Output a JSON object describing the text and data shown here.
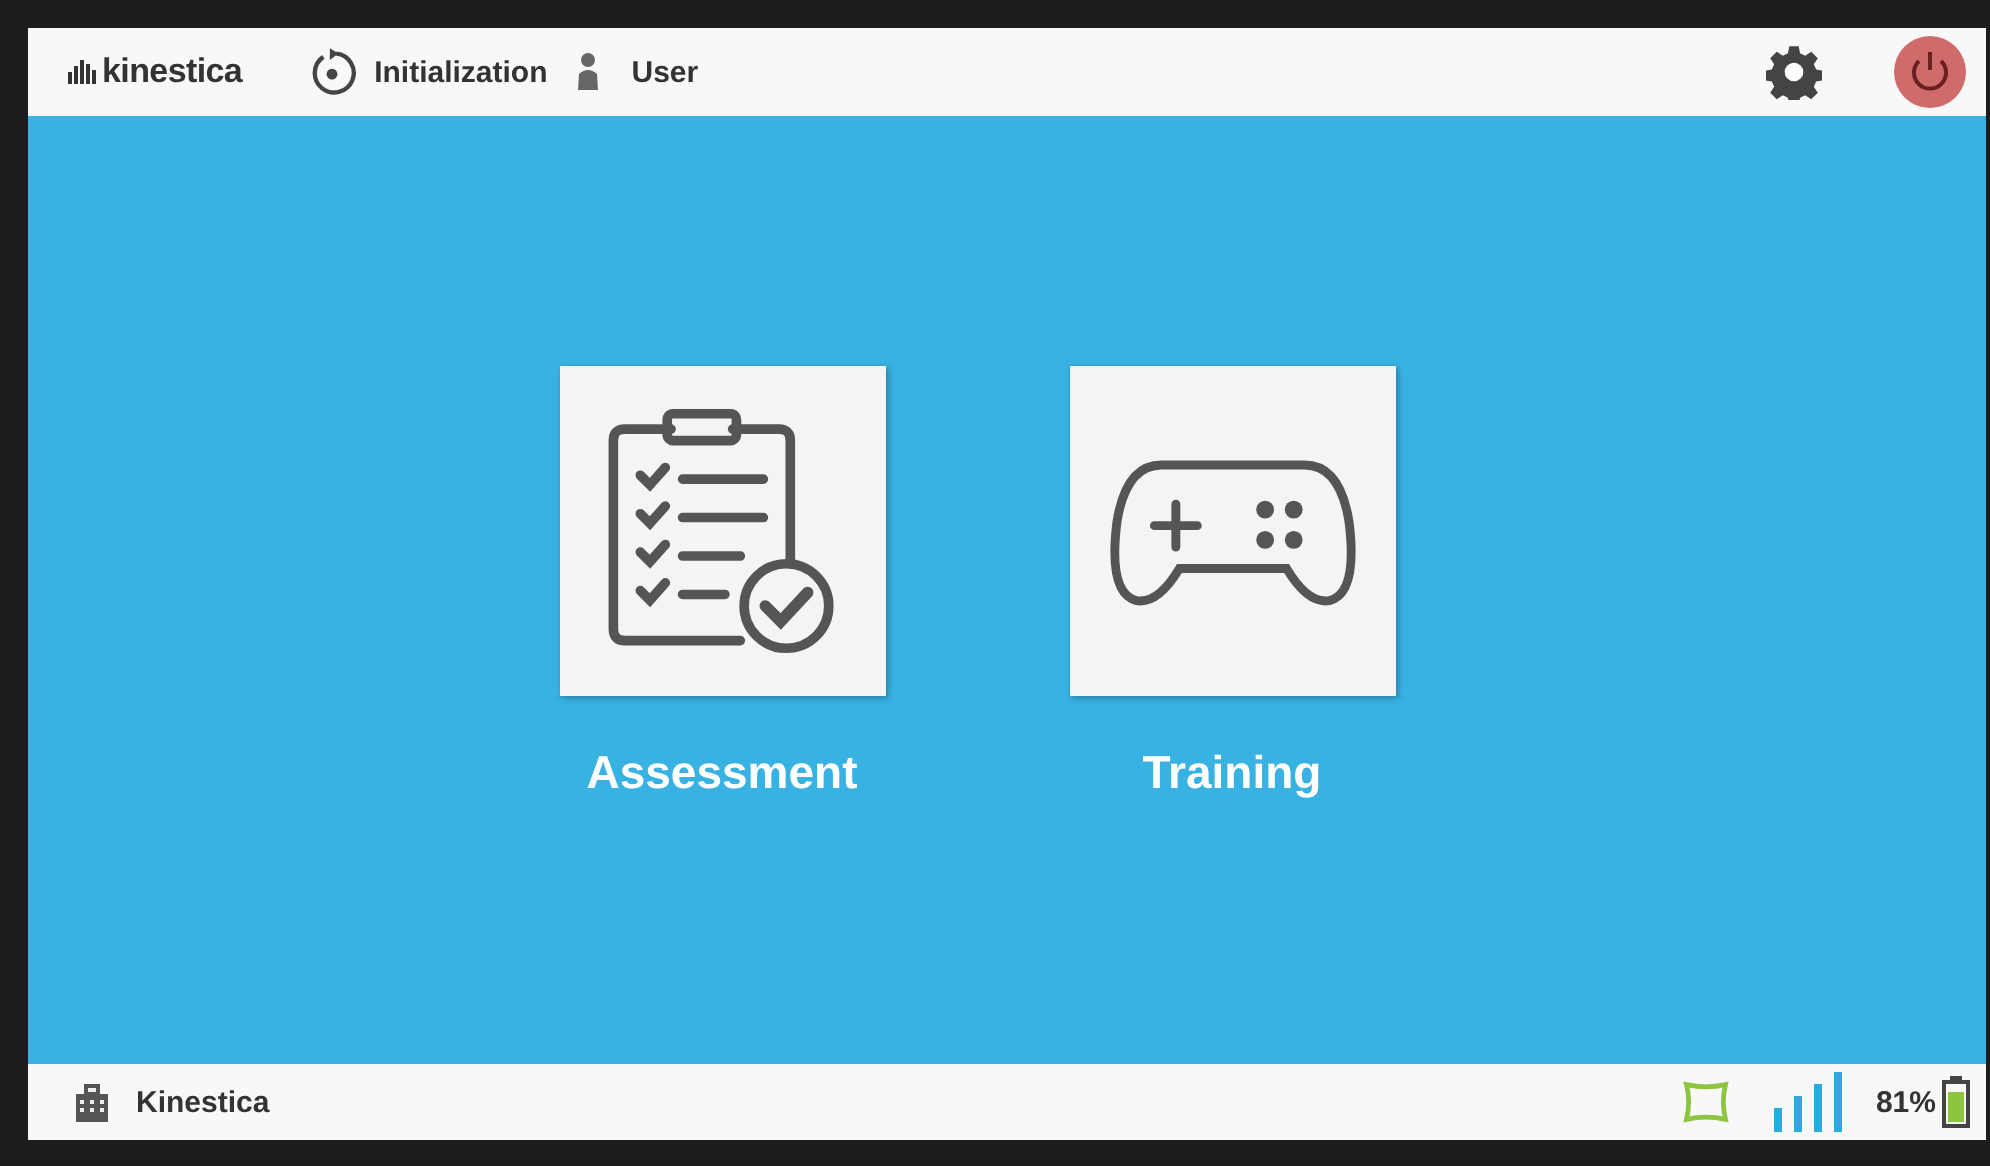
{
  "header": {
    "logo": "kinestica",
    "status": "Initialization",
    "user": "User"
  },
  "tiles": [
    {
      "kind": "assessment",
      "label": "Assessment"
    },
    {
      "kind": "training",
      "label": "Training"
    }
  ],
  "footer": {
    "site": "Kinestica",
    "battery": "81%"
  }
}
